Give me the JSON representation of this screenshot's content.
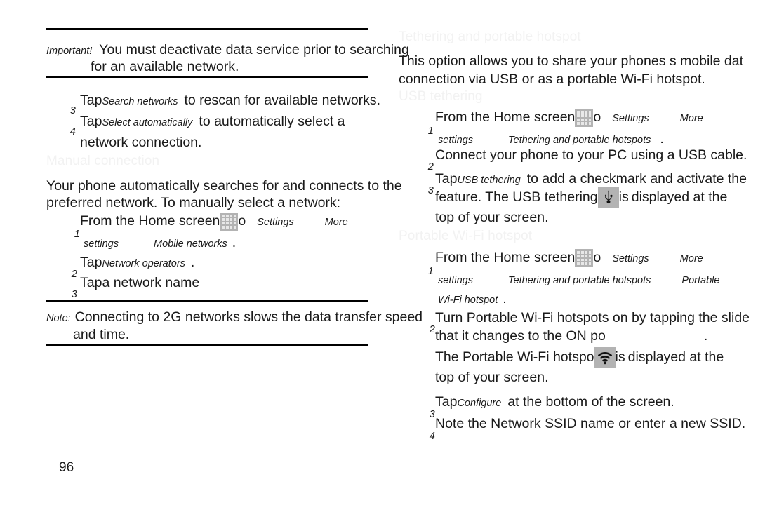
{
  "page": {
    "number": "96",
    "accent_gray_heading": "#f2f2f2",
    "chip_bg": "#b3b3b3",
    "text_color": "#1a1a1a"
  },
  "left_column": {
    "important_box": {
      "label": "Important!",
      "line1": "You must deactivate data service prior to searching",
      "line2": "for an available network."
    },
    "steps_top": [
      {
        "number": "3",
        "prefix": "Tap",
        "term": "Search networks",
        "suffix": "to rescan for available networks."
      },
      {
        "number": "4",
        "prefix": "Tap",
        "term": "Select automatically",
        "suffix": "to automatically select a",
        "continuation": "network connection."
      }
    ],
    "manual_connection": {
      "heading": "Manual connection",
      "intro_line1": "Your phone automatically searches for and connects to the",
      "intro_line2": "preferred network. To manually select a network:",
      "steps": [
        {
          "number": "1",
          "text_before_icon": "From the Home screen",
          "icon": "apps-icon",
          "text_after_icon": "o",
          "term1": "Settings",
          "term2": "More",
          "term3": "settings",
          "term4": "Mobile networks",
          "period": "."
        },
        {
          "number": "2",
          "prefix": "Tap",
          "term": "Network operators",
          "period": "."
        },
        {
          "number": "3",
          "prefix": "Tap",
          "suffix": "a network name"
        }
      ]
    },
    "note_box": {
      "label": "Note:",
      "line1": "Connecting to 2G networks slows the data transfer speed",
      "line2": "and time."
    }
  },
  "right_column": {
    "heading": "Tethering and portable hotspot",
    "intro_line1": "This option allows you to share your phones s mobile dat",
    "intro_line2": "connection via USB or as a portable Wi-Fi hotspot.",
    "usb_tethering": {
      "heading": "USB tethering",
      "steps": [
        {
          "number": "1",
          "text_before_icon": "From the Home screen",
          "icon": "apps-icon",
          "text_after_icon": "o",
          "term1": "Settings",
          "term2": "More",
          "term3": "settings",
          "term4": "Tethering and portable hotspots",
          "period": "."
        },
        {
          "number": "2",
          "text": "Connect your phone to your PC using a USB cable."
        },
        {
          "number": "3",
          "prefix": "Tap",
          "term": "USB tethering",
          "suffix": "to add a checkmark and activate the",
          "line2_before_icon": "feature. The USB tethering",
          "icon": "usb-icon",
          "line2_after_icon": "is",
          "line2_tail": "displayed at the",
          "line3": "top of your screen."
        }
      ]
    },
    "portable_hotspot": {
      "heading": "Portable Wi-Fi hotspot",
      "steps": [
        {
          "number": "1",
          "text_before_icon": "From the Home screen",
          "icon": "apps-icon",
          "text_after_icon": "o",
          "term1": "Settings",
          "term2": "More",
          "term3": "settings",
          "term4": "Tethering and portable hotspots",
          "term5": "Portable",
          "term6": "Wi-Fi hotspot",
          "period": "."
        },
        {
          "number": "2",
          "line1": "Turn Portable Wi-Fi hotspots on by tapping the slide",
          "line2": "that it changes to the ON po",
          "line2_period": ".",
          "line3_before_icon": "The Portable Wi-Fi hotspo",
          "icon": "wifi-icon",
          "line3_after_icon": "is",
          "line3_tail": "displayed at the",
          "line4": "top of your screen."
        },
        {
          "number": "3",
          "prefix": "Tap",
          "term": "Configure",
          "suffix": "at the bottom of the screen."
        },
        {
          "number": "4",
          "text": "Note the Network SSID name or enter a new SSID."
        }
      ]
    }
  }
}
